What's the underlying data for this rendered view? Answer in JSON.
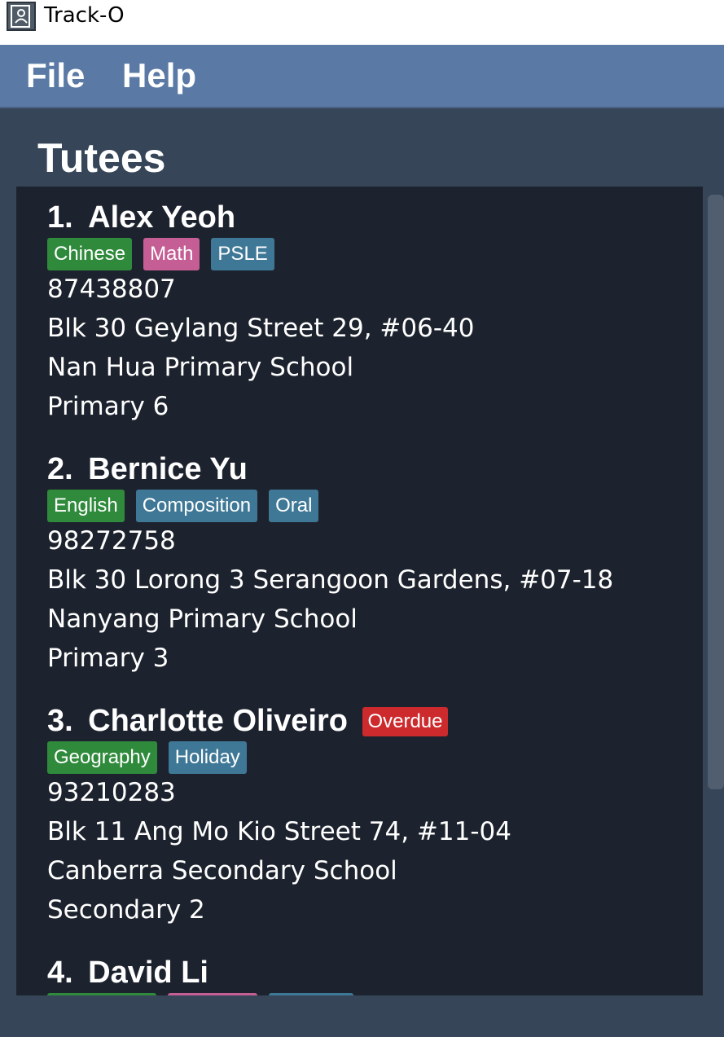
{
  "window": {
    "title": "Track-O"
  },
  "menu": {
    "file": "File",
    "help": "Help"
  },
  "section_title": "Tutees",
  "tutees": [
    {
      "index": "1.",
      "name": "Alex Yeoh",
      "tags": [
        {
          "label": "Chinese",
          "color": "#2f8a3b"
        },
        {
          "label": "Math",
          "color": "#c45e94"
        },
        {
          "label": "PSLE",
          "color": "#3f7896"
        }
      ],
      "phone": "87438807",
      "address": "Blk 30 Geylang Street 29, #06-40",
      "school": "Nan Hua Primary School",
      "level": "Primary 6"
    },
    {
      "index": "2.",
      "name": "Bernice Yu",
      "tags": [
        {
          "label": "English",
          "color": "#2f8a3b"
        },
        {
          "label": "Composition",
          "color": "#3f7896"
        },
        {
          "label": "Oral",
          "color": "#3f7896"
        }
      ],
      "phone": "98272758",
      "address": "Blk 30 Lorong 3 Serangoon Gardens, #07-18",
      "school": "Nanyang Primary School",
      "level": "Primary 3"
    },
    {
      "index": "3.",
      "name": "Charlotte Oliveiro",
      "status": "Overdue",
      "tags": [
        {
          "label": "Geography",
          "color": "#2f8a3b"
        },
        {
          "label": "Holiday",
          "color": "#3f7896"
        }
      ],
      "phone": "93210283",
      "address": "Blk 11 Ang Mo Kio Street 74, #11-04",
      "school": "Canberra Secondary School",
      "level": "Secondary 2"
    },
    {
      "index": "4.",
      "name": "David Li"
    }
  ]
}
